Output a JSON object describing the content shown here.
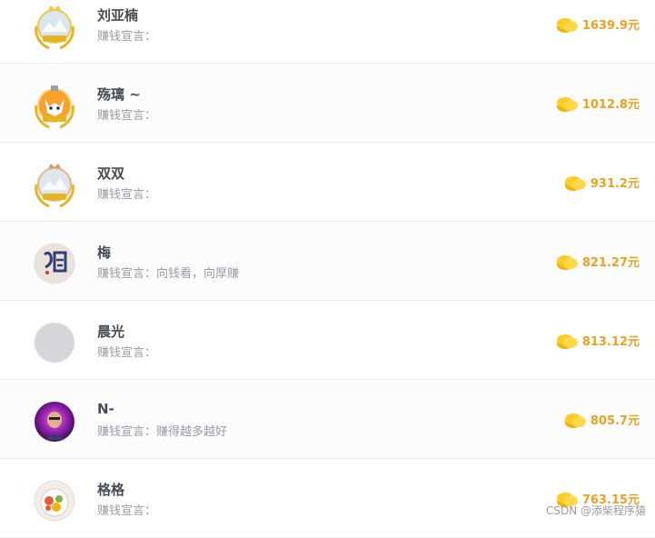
{
  "ranking": {
    "slogan_label": "赚钱宣言：",
    "currency": "元",
    "items": [
      {
        "name": "刘亚楠",
        "slogan": "",
        "amount": "1639.9",
        "avatar": "gold-crown-laurel-badge-icon"
      },
      {
        "name": "殇璃 ~",
        "slogan": "",
        "amount": "1012.8",
        "avatar": "silver-crown-fox-badge-icon"
      },
      {
        "name": "双双",
        "slogan": "",
        "amount": "931.2",
        "avatar": "bronze-crown-laurel-badge-icon"
      },
      {
        "name": "梅",
        "slogan": "向钱看，向厚赚",
        "amount": "821.27",
        "avatar": "calligraphy-avatar-icon"
      },
      {
        "name": "晨光",
        "slogan": "",
        "amount": "813.12",
        "avatar": "blank-avatar-icon"
      },
      {
        "name": "N-",
        "slogan": "赚得越多越好",
        "amount": "805.7",
        "avatar": "photo-avatar-icon"
      },
      {
        "name": "格格",
        "slogan": "",
        "amount": "763.15",
        "avatar": "food-photo-avatar-icon"
      }
    ]
  },
  "watermark": "CSDN @添柴程序猿",
  "colors": {
    "amount": "#f0a020",
    "name": "#4a4a55",
    "slogan": "#9a9aa2",
    "coin": "#ffcc22"
  }
}
